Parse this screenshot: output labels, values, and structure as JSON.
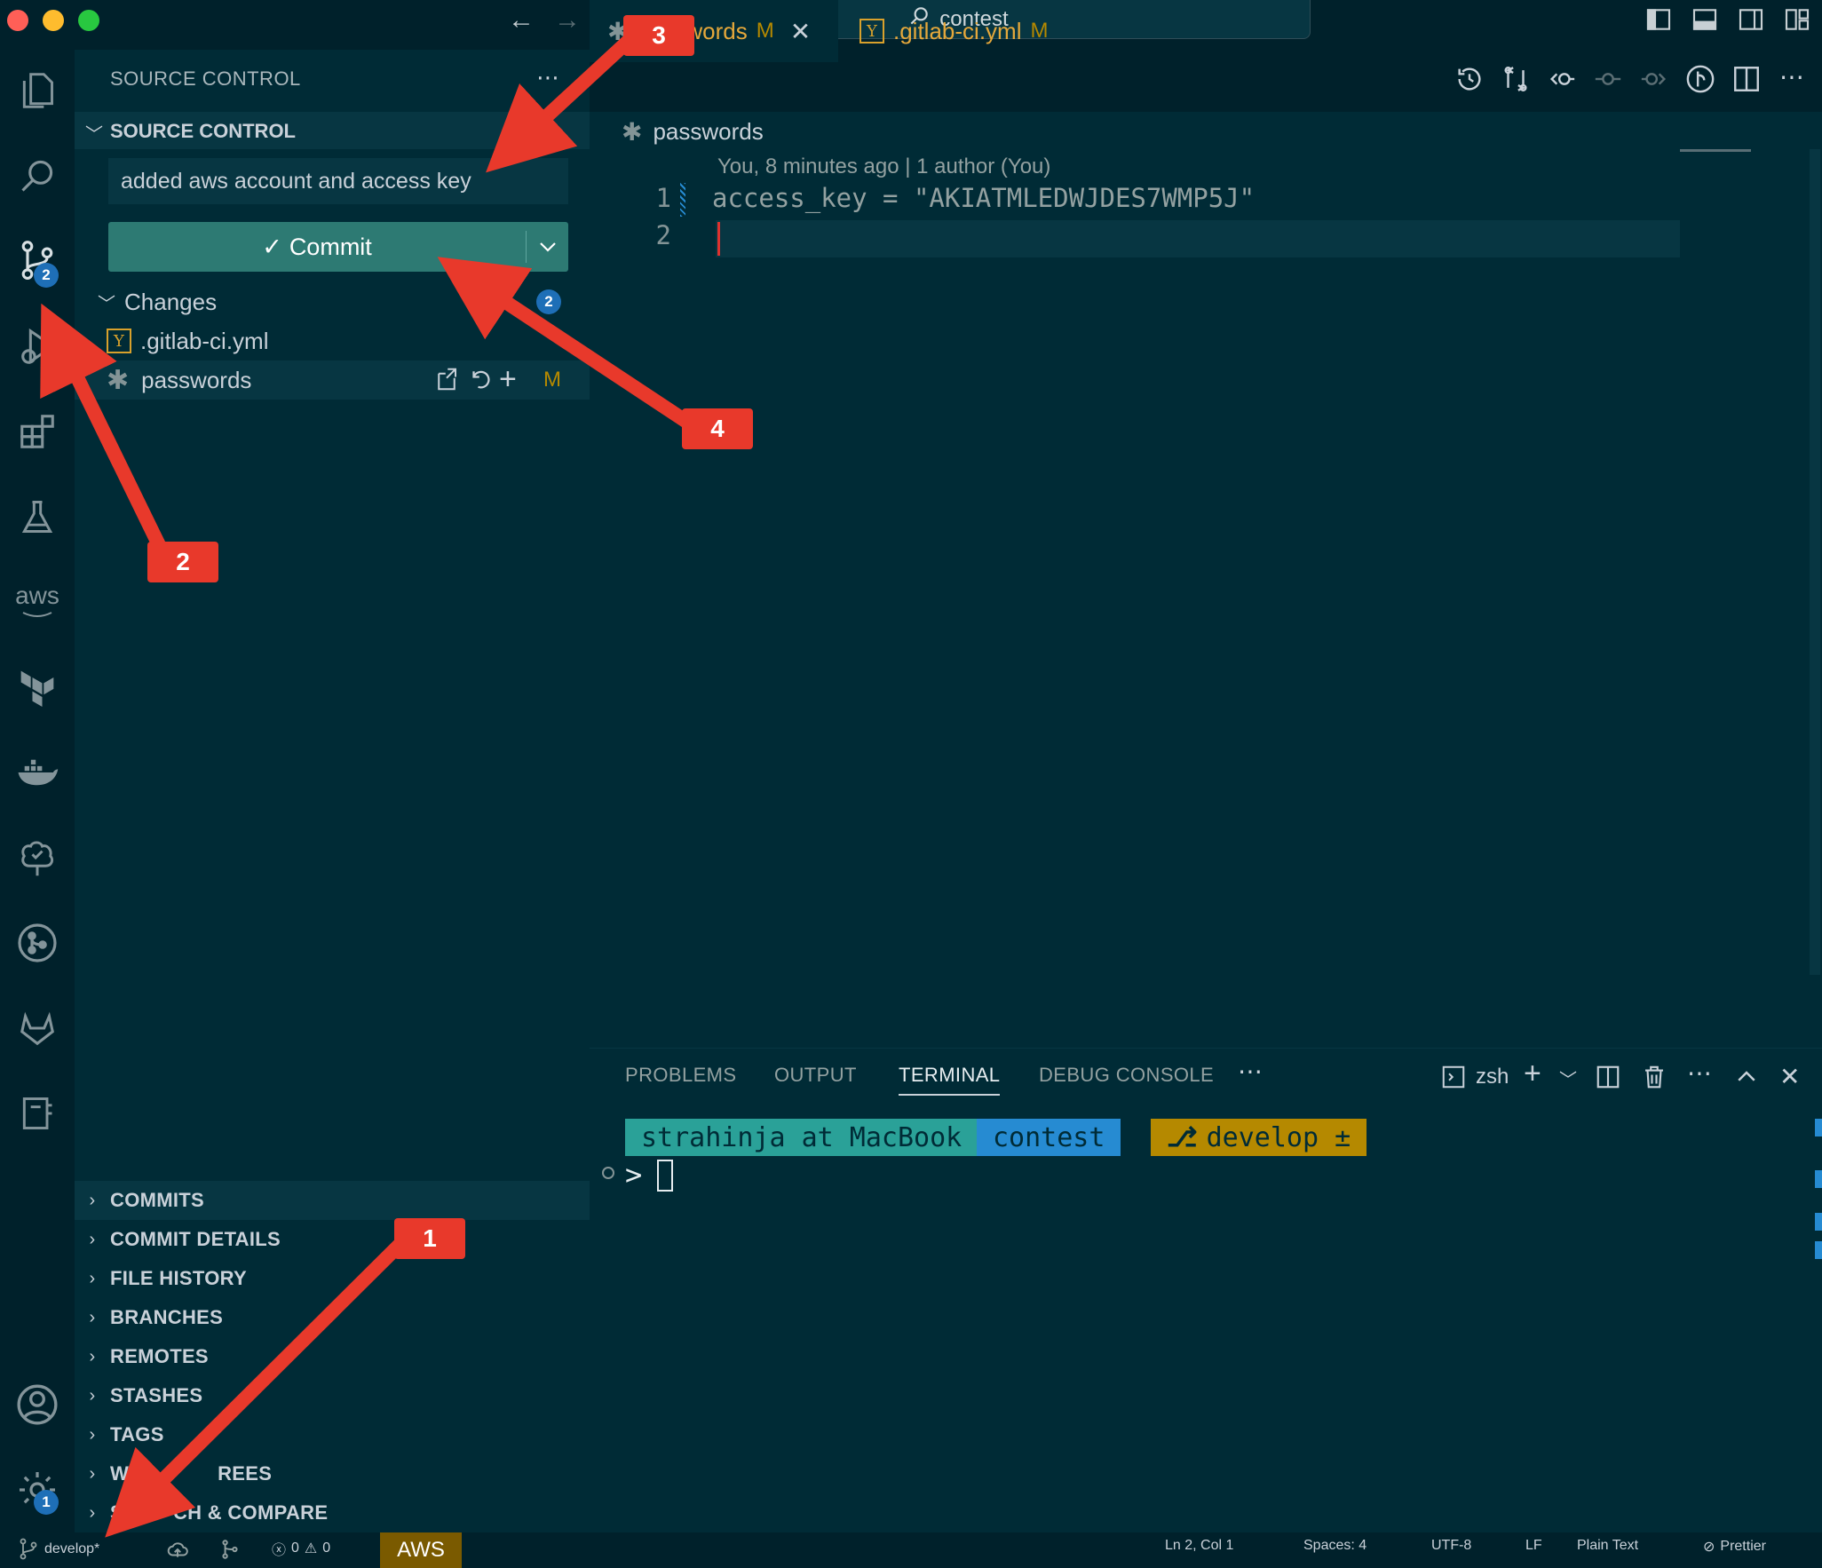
{
  "window": {
    "search_text": "contest"
  },
  "sidebar": {
    "header": "SOURCE CONTROL",
    "section_title": "SOURCE CONTROL",
    "commit_message": "added aws account and access key",
    "commit_label": "Commit",
    "changes_label": "Changes",
    "changes_count": "2",
    "files": [
      {
        "name": ".gitlab-ci.yml",
        "status": ""
      },
      {
        "name": "passwords",
        "status": "M"
      }
    ],
    "lower_sections": [
      "COMMITS",
      "COMMIT DETAILS",
      "FILE HISTORY",
      "BRANCHES",
      "REMOTES",
      "STASHES",
      "TAGS",
      "W",
      "REES",
      "S",
      "CH & COMPARE"
    ]
  },
  "activity": {
    "scm_badge": "2",
    "settings_badge": "1",
    "aws_label": "aws"
  },
  "editor": {
    "tabs": [
      {
        "label": "passwords",
        "status": "M"
      },
      {
        "label": ".gitlab-ci.yml",
        "status": "M"
      }
    ],
    "breadcrumb": "passwords",
    "blame": "You, 8 minutes ago | 1 author (You)",
    "lines": [
      {
        "no": "1",
        "text": "access_key = \"AKIATMLEDWJDES7WMP5J\""
      },
      {
        "no": "2",
        "text": ""
      }
    ]
  },
  "panel": {
    "tabs": [
      "PROBLEMS",
      "OUTPUT",
      "TERMINAL",
      "DEBUG CONSOLE"
    ],
    "active_tab": "TERMINAL",
    "shell": "zsh",
    "prompt": {
      "user": "strahinja at MacBook",
      "dir": "contest",
      "branch": "develop ±",
      "symbol": ">"
    }
  },
  "statusbar": {
    "branch": "develop*",
    "errors": "0",
    "warnings": "0",
    "aws": "AWS",
    "position": "Ln 2, Col 1",
    "spaces": "Spaces: 4",
    "encoding": "UTF-8",
    "eol": "LF",
    "language": "Plain Text",
    "formatter": "Prettier"
  },
  "annotations": [
    "1",
    "2",
    "3",
    "4"
  ],
  "colors": {
    "accent_red": "#e8392b",
    "commit_button": "#2d7a73",
    "badge_blue": "#1e6fb7",
    "background": "#002b36"
  }
}
